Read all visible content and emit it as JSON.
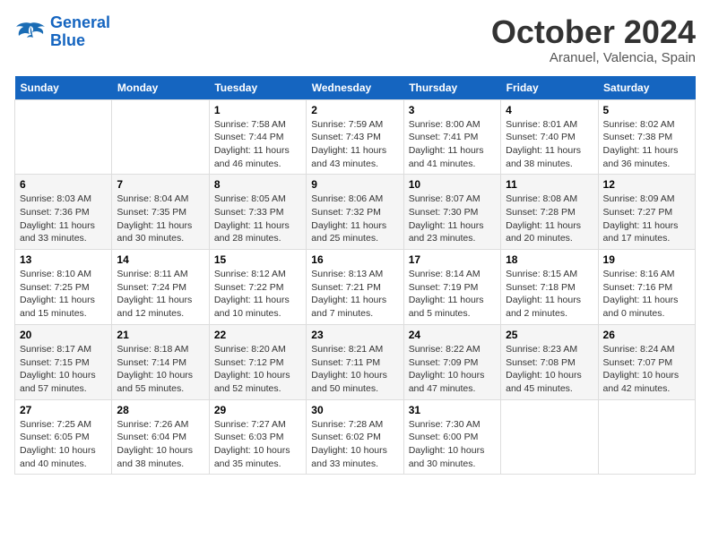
{
  "logo": {
    "line1": "General",
    "line2": "Blue"
  },
  "title": "October 2024",
  "subtitle": "Aranuel, Valencia, Spain",
  "headers": [
    "Sunday",
    "Monday",
    "Tuesday",
    "Wednesday",
    "Thursday",
    "Friday",
    "Saturday"
  ],
  "weeks": [
    [
      {
        "day": "",
        "info": ""
      },
      {
        "day": "",
        "info": ""
      },
      {
        "day": "1",
        "info": "Sunrise: 7:58 AM\nSunset: 7:44 PM\nDaylight: 11 hours and 46 minutes."
      },
      {
        "day": "2",
        "info": "Sunrise: 7:59 AM\nSunset: 7:43 PM\nDaylight: 11 hours and 43 minutes."
      },
      {
        "day": "3",
        "info": "Sunrise: 8:00 AM\nSunset: 7:41 PM\nDaylight: 11 hours and 41 minutes."
      },
      {
        "day": "4",
        "info": "Sunrise: 8:01 AM\nSunset: 7:40 PM\nDaylight: 11 hours and 38 minutes."
      },
      {
        "day": "5",
        "info": "Sunrise: 8:02 AM\nSunset: 7:38 PM\nDaylight: 11 hours and 36 minutes."
      }
    ],
    [
      {
        "day": "6",
        "info": "Sunrise: 8:03 AM\nSunset: 7:36 PM\nDaylight: 11 hours and 33 minutes."
      },
      {
        "day": "7",
        "info": "Sunrise: 8:04 AM\nSunset: 7:35 PM\nDaylight: 11 hours and 30 minutes."
      },
      {
        "day": "8",
        "info": "Sunrise: 8:05 AM\nSunset: 7:33 PM\nDaylight: 11 hours and 28 minutes."
      },
      {
        "day": "9",
        "info": "Sunrise: 8:06 AM\nSunset: 7:32 PM\nDaylight: 11 hours and 25 minutes."
      },
      {
        "day": "10",
        "info": "Sunrise: 8:07 AM\nSunset: 7:30 PM\nDaylight: 11 hours and 23 minutes."
      },
      {
        "day": "11",
        "info": "Sunrise: 8:08 AM\nSunset: 7:28 PM\nDaylight: 11 hours and 20 minutes."
      },
      {
        "day": "12",
        "info": "Sunrise: 8:09 AM\nSunset: 7:27 PM\nDaylight: 11 hours and 17 minutes."
      }
    ],
    [
      {
        "day": "13",
        "info": "Sunrise: 8:10 AM\nSunset: 7:25 PM\nDaylight: 11 hours and 15 minutes."
      },
      {
        "day": "14",
        "info": "Sunrise: 8:11 AM\nSunset: 7:24 PM\nDaylight: 11 hours and 12 minutes."
      },
      {
        "day": "15",
        "info": "Sunrise: 8:12 AM\nSunset: 7:22 PM\nDaylight: 11 hours and 10 minutes."
      },
      {
        "day": "16",
        "info": "Sunrise: 8:13 AM\nSunset: 7:21 PM\nDaylight: 11 hours and 7 minutes."
      },
      {
        "day": "17",
        "info": "Sunrise: 8:14 AM\nSunset: 7:19 PM\nDaylight: 11 hours and 5 minutes."
      },
      {
        "day": "18",
        "info": "Sunrise: 8:15 AM\nSunset: 7:18 PM\nDaylight: 11 hours and 2 minutes."
      },
      {
        "day": "19",
        "info": "Sunrise: 8:16 AM\nSunset: 7:16 PM\nDaylight: 11 hours and 0 minutes."
      }
    ],
    [
      {
        "day": "20",
        "info": "Sunrise: 8:17 AM\nSunset: 7:15 PM\nDaylight: 10 hours and 57 minutes."
      },
      {
        "day": "21",
        "info": "Sunrise: 8:18 AM\nSunset: 7:14 PM\nDaylight: 10 hours and 55 minutes."
      },
      {
        "day": "22",
        "info": "Sunrise: 8:20 AM\nSunset: 7:12 PM\nDaylight: 10 hours and 52 minutes."
      },
      {
        "day": "23",
        "info": "Sunrise: 8:21 AM\nSunset: 7:11 PM\nDaylight: 10 hours and 50 minutes."
      },
      {
        "day": "24",
        "info": "Sunrise: 8:22 AM\nSunset: 7:09 PM\nDaylight: 10 hours and 47 minutes."
      },
      {
        "day": "25",
        "info": "Sunrise: 8:23 AM\nSunset: 7:08 PM\nDaylight: 10 hours and 45 minutes."
      },
      {
        "day": "26",
        "info": "Sunrise: 8:24 AM\nSunset: 7:07 PM\nDaylight: 10 hours and 42 minutes."
      }
    ],
    [
      {
        "day": "27",
        "info": "Sunrise: 7:25 AM\nSunset: 6:05 PM\nDaylight: 10 hours and 40 minutes."
      },
      {
        "day": "28",
        "info": "Sunrise: 7:26 AM\nSunset: 6:04 PM\nDaylight: 10 hours and 38 minutes."
      },
      {
        "day": "29",
        "info": "Sunrise: 7:27 AM\nSunset: 6:03 PM\nDaylight: 10 hours and 35 minutes."
      },
      {
        "day": "30",
        "info": "Sunrise: 7:28 AM\nSunset: 6:02 PM\nDaylight: 10 hours and 33 minutes."
      },
      {
        "day": "31",
        "info": "Sunrise: 7:30 AM\nSunset: 6:00 PM\nDaylight: 10 hours and 30 minutes."
      },
      {
        "day": "",
        "info": ""
      },
      {
        "day": "",
        "info": ""
      }
    ]
  ]
}
